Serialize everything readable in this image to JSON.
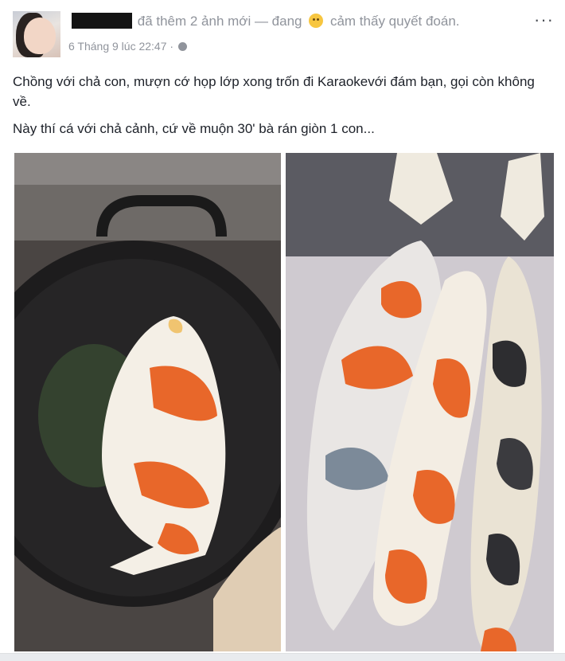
{
  "post": {
    "author_action": "đã thêm 2 ảnh mới — đang",
    "feeling": "cảm thấy quyết đoán.",
    "timestamp": "6 Tháng 9 lúc 22:47 ·",
    "more_label": "···",
    "text_line1": "Chồng với chả con, mượn cớ họp lớp xong trốn đi Karaokevới đám bạn, gọi còn không về.",
    "text_line2": "Này thí cá với chả cảnh, cứ về muộn 30' bà rán giòn 1 con..."
  },
  "colors": {
    "link": "#365899",
    "meta": "#90949c",
    "text": "#1d2129",
    "koi_orange": "#e8672a"
  }
}
